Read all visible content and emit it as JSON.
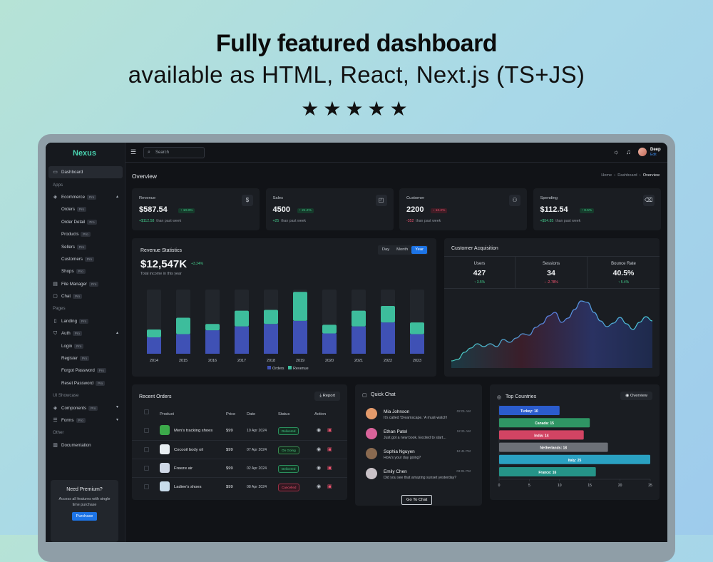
{
  "hero": {
    "title": "Fully featured dashboard",
    "subtitle": "available as HTML, React, Next.js (TS+JS)",
    "stars": "★★★★★"
  },
  "sidebar": {
    "logo": "Nexus",
    "items": [
      {
        "label": "Dashboard"
      },
      {
        "label": "Apps"
      },
      {
        "label": "Ecommerce",
        "pro": "Pro"
      },
      {
        "label": "Orders",
        "pro": "Pro"
      },
      {
        "label": "Order Detail",
        "pro": "Pro"
      },
      {
        "label": "Products",
        "pro": "Pro"
      },
      {
        "label": "Sellers",
        "pro": "Pro"
      },
      {
        "label": "Customers",
        "pro": "Pro"
      },
      {
        "label": "Shops",
        "pro": "Pro"
      },
      {
        "label": "File Manager",
        "pro": "Pro"
      },
      {
        "label": "Chat",
        "pro": "Pro"
      },
      {
        "label": "Pages"
      },
      {
        "label": "Landing",
        "pro": "Pro"
      },
      {
        "label": "Auth",
        "pro": "Pro"
      },
      {
        "label": "Login",
        "pro": "Pro"
      },
      {
        "label": "Register",
        "pro": "Pro"
      },
      {
        "label": "Forgot Password",
        "pro": "Pro"
      },
      {
        "label": "Reset Password",
        "pro": "Pro"
      },
      {
        "label": "UI Showcase"
      },
      {
        "label": "Components",
        "pro": "Pro"
      },
      {
        "label": "Forms",
        "pro": "Pro"
      },
      {
        "label": "Other"
      },
      {
        "label": "Documentation"
      }
    ],
    "premium": {
      "title": "Need Premium?",
      "desc": "Access all features with single time purchase",
      "button": "Purchase"
    }
  },
  "topbar": {
    "search_placeholder": "Search",
    "user": {
      "name": "Deep",
      "role": "Edit"
    }
  },
  "overview": {
    "title": "Overview",
    "breadcrumb": [
      "Home",
      "Dashboard",
      "Overview"
    ]
  },
  "stats": [
    {
      "label": "Revenue",
      "value": "$587.54",
      "change": "↑ 10.8%",
      "dir": "up",
      "delta": "+$112.58",
      "note": "than past week",
      "icon": "$"
    },
    {
      "label": "Sales",
      "value": "4500",
      "change": "↑ 21.2%",
      "dir": "up",
      "delta": "+25",
      "note": "than past week",
      "icon": "◰"
    },
    {
      "label": "Customer",
      "value": "2200",
      "change": "↓ 12.2%",
      "dir": "down",
      "delta": "-352",
      "note": "than past week",
      "icon": "⚇"
    },
    {
      "label": "Spending",
      "value": "$112.54",
      "change": "↑ 8.5%",
      "dir": "up",
      "delta": "+$54.85",
      "note": "than past week",
      "icon": "⌫"
    }
  ],
  "revenue": {
    "title": "Revenue Statistics",
    "value": "$12,547K",
    "change": "+3.24%",
    "sub": "Total income in this year",
    "tabs": [
      "Day",
      "Month",
      "Year"
    ],
    "active_tab": "Year",
    "legend": [
      "Orders",
      "Revenue"
    ],
    "colors": {
      "orders": "#3f51b5",
      "revenue": "#3dbd9c",
      "track": "#22262c"
    }
  },
  "chart_data": {
    "type": "bar",
    "categories": [
      "2014",
      "2015",
      "2016",
      "2017",
      "2018",
      "2019",
      "2020",
      "2021",
      "2022",
      "2023"
    ],
    "series": [
      {
        "name": "Orders",
        "values": [
          21,
          25,
          30,
          35,
          38,
          42,
          26,
          35,
          40,
          25
        ]
      },
      {
        "name": "Revenue",
        "values": [
          10,
          21,
          8,
          20,
          18,
          37,
          11,
          20,
          21,
          15
        ]
      }
    ],
    "ylim": [
      0,
      82
    ]
  },
  "acquisition": {
    "title": "Customer Acquisition",
    "metrics": [
      {
        "label": "Users",
        "value": "427",
        "change": "↑ 3.5%",
        "dir": "up"
      },
      {
        "label": "Sessions",
        "value": "34",
        "change": "↓ -2.78%",
        "dir": "down"
      },
      {
        "label": "Bounce Rate",
        "value": "40.5%",
        "change": "↑ 5.4%",
        "dir": "up"
      }
    ],
    "trend": [
      10,
      12,
      22,
      28,
      34,
      30,
      34,
      30,
      40,
      36,
      42,
      48,
      46,
      57,
      62,
      73,
      78,
      64,
      70,
      82,
      94,
      92,
      78,
      66,
      58,
      63,
      71,
      62,
      54,
      64,
      72,
      66
    ]
  },
  "orders": {
    "title": "Recent Orders",
    "report": "Report",
    "headers": [
      "Product",
      "Price",
      "Date",
      "Status",
      "Action"
    ],
    "rows": [
      {
        "product": "Men's tracking shoes",
        "price": "$99",
        "date": "10 Apr 2024",
        "status": "Delivered",
        "cls": "s-del",
        "color": "#3ca94a"
      },
      {
        "product": "Cocooil body oil",
        "price": "$99",
        "date": "07 Apr 2024",
        "status": "On Going",
        "cls": "s-on",
        "color": "#e8eef2"
      },
      {
        "product": "Freeze air",
        "price": "$99",
        "date": "02 Apr 2024",
        "status": "Delivered",
        "cls": "s-del",
        "color": "#cfd8e6"
      },
      {
        "product": "Ladiee's shoes",
        "price": "$99",
        "date": "08 Apr 2024",
        "status": "Cancelled",
        "cls": "s-can",
        "color": "#c8dceb"
      }
    ]
  },
  "quickchat": {
    "title": "Quick Chat",
    "button": "Go To Chat",
    "messages": [
      {
        "name": "Mia Johnson",
        "msg": "It's called 'Dreamscape.' A must-watch!",
        "time": "02:01 AM",
        "color": "#e39a6b"
      },
      {
        "name": "Ethan Patel",
        "msg": "Just got a new book. Excited to start...",
        "time": "12:21 AM",
        "color": "#d9639a"
      },
      {
        "name": "Sophia Nguyen",
        "msg": "How's your day going?",
        "time": "12:41 PM",
        "color": "#8a6a50"
      },
      {
        "name": "Emily Chen",
        "msg": "Did you see that amazing sunset yesterday?",
        "time": "03:01 PM",
        "color": "#c9c2c7"
      }
    ]
  },
  "countries": {
    "title": "Top Countries",
    "button": "Overview",
    "bars": [
      {
        "label": "Turkey: 10",
        "value": 10,
        "color": "#2b5ccd"
      },
      {
        "label": "Canada: 15",
        "value": 15,
        "color": "#2f9664"
      },
      {
        "label": "India: 14",
        "value": 14,
        "color": "#d24463"
      },
      {
        "label": "Netherlands: 18",
        "value": 18,
        "color": "#6c7077"
      },
      {
        "label": "Italy: 25",
        "value": 25,
        "color": "#2aa1c2"
      },
      {
        "label": "France: 16",
        "value": 16,
        "color": "#259488"
      }
    ],
    "ticks": [
      "0",
      "5",
      "10",
      "15",
      "20",
      "25"
    ],
    "max": 25
  }
}
